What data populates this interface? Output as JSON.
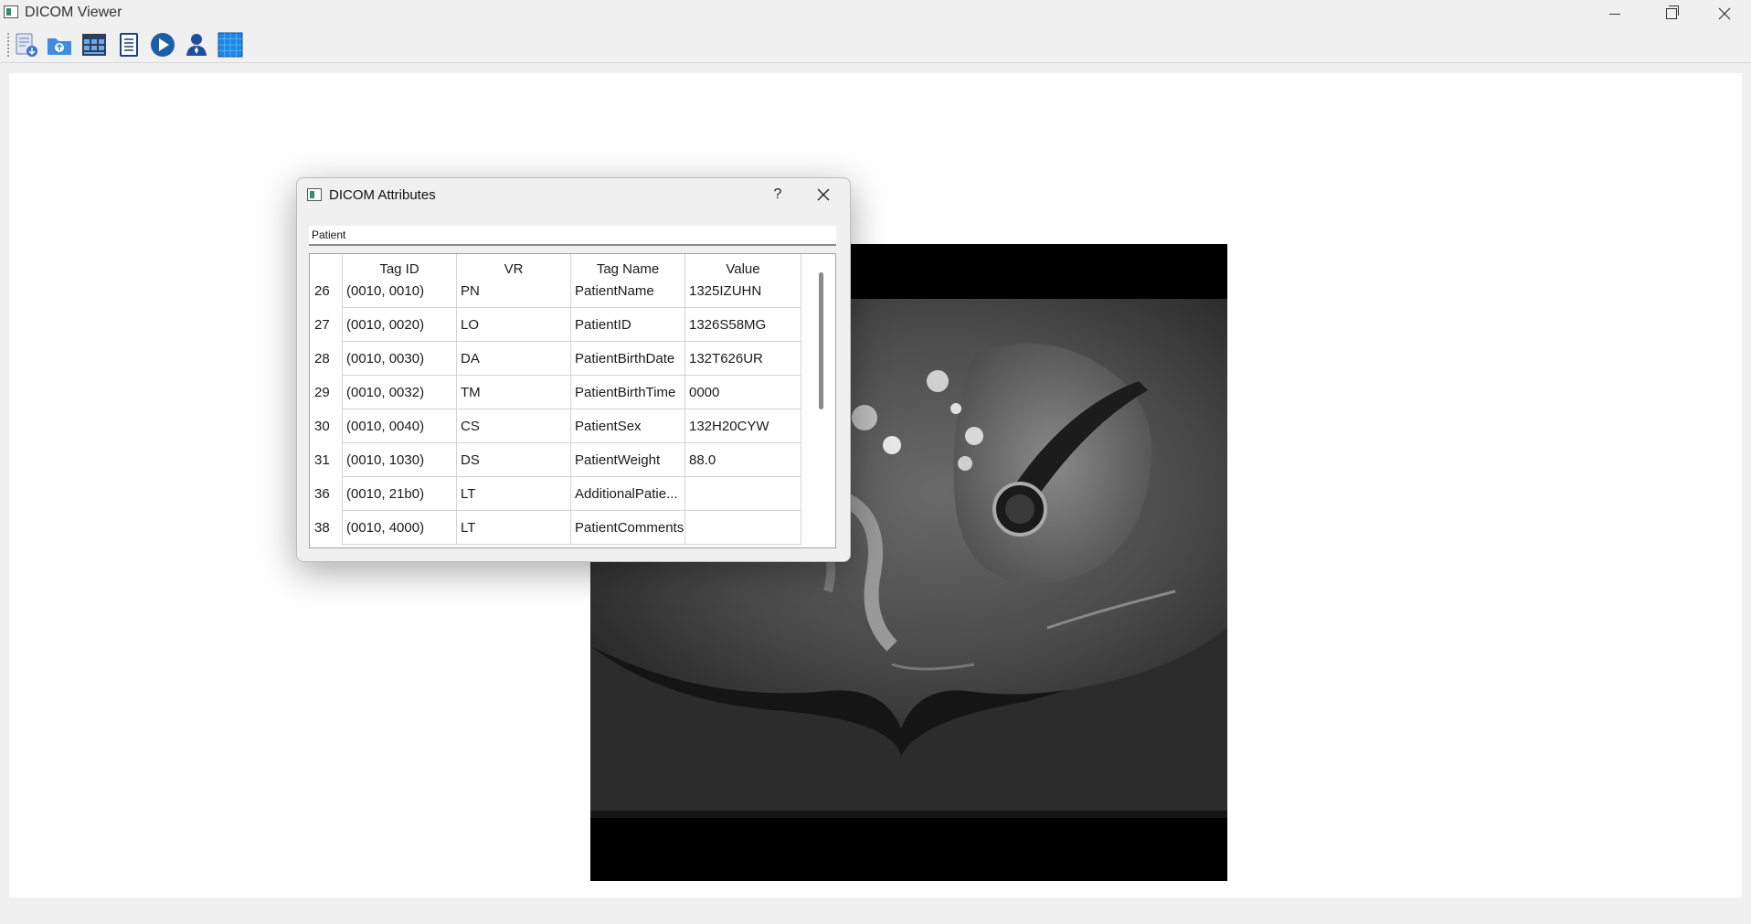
{
  "window": {
    "title": "DICOM Viewer"
  },
  "toolbar": {
    "buttons": [
      {
        "name": "open-file",
        "icon": "document-download-icon"
      },
      {
        "name": "open-folder",
        "icon": "folder-upload-icon"
      },
      {
        "name": "series-view",
        "icon": "grid-layout-icon"
      },
      {
        "name": "attributes",
        "icon": "list-document-icon"
      },
      {
        "name": "play",
        "icon": "play-icon"
      },
      {
        "name": "patient",
        "icon": "person-icon"
      },
      {
        "name": "grid",
        "icon": "grid-icon"
      }
    ]
  },
  "dialog": {
    "title": "DICOM Attributes",
    "help": "?",
    "close": "✕",
    "filter_value": "Patient",
    "columns": [
      "",
      "Tag ID",
      "VR",
      "Tag Name",
      "Value"
    ],
    "rows": [
      {
        "num": "26",
        "tag": "(0010, 0010)",
        "vr": "PN",
        "name": "PatientName",
        "value": "1325IZUHN"
      },
      {
        "num": "27",
        "tag": "(0010, 0020)",
        "vr": "LO",
        "name": "PatientID",
        "value": "1326S58MG"
      },
      {
        "num": "28",
        "tag": "(0010, 0030)",
        "vr": "DA",
        "name": "PatientBirthDate",
        "value": "132T626UR"
      },
      {
        "num": "29",
        "tag": "(0010, 0032)",
        "vr": "TM",
        "name": "PatientBirthTime",
        "value": "0000"
      },
      {
        "num": "30",
        "tag": "(0010, 0040)",
        "vr": "CS",
        "name": "PatientSex",
        "value": "132H20CYW"
      },
      {
        "num": "31",
        "tag": "(0010, 1030)",
        "vr": "DS",
        "name": "PatientWeight",
        "value": "88.0"
      },
      {
        "num": "36",
        "tag": "(0010, 21b0)",
        "vr": "LT",
        "name": "AdditionalPatie...",
        "value": ""
      },
      {
        "num": "38",
        "tag": "(0010, 4000)",
        "vr": "LT",
        "name": "PatientComments",
        "value": ""
      }
    ]
  },
  "colors": {
    "accent": "#1e5fa8",
    "image_bg": "#000000"
  }
}
